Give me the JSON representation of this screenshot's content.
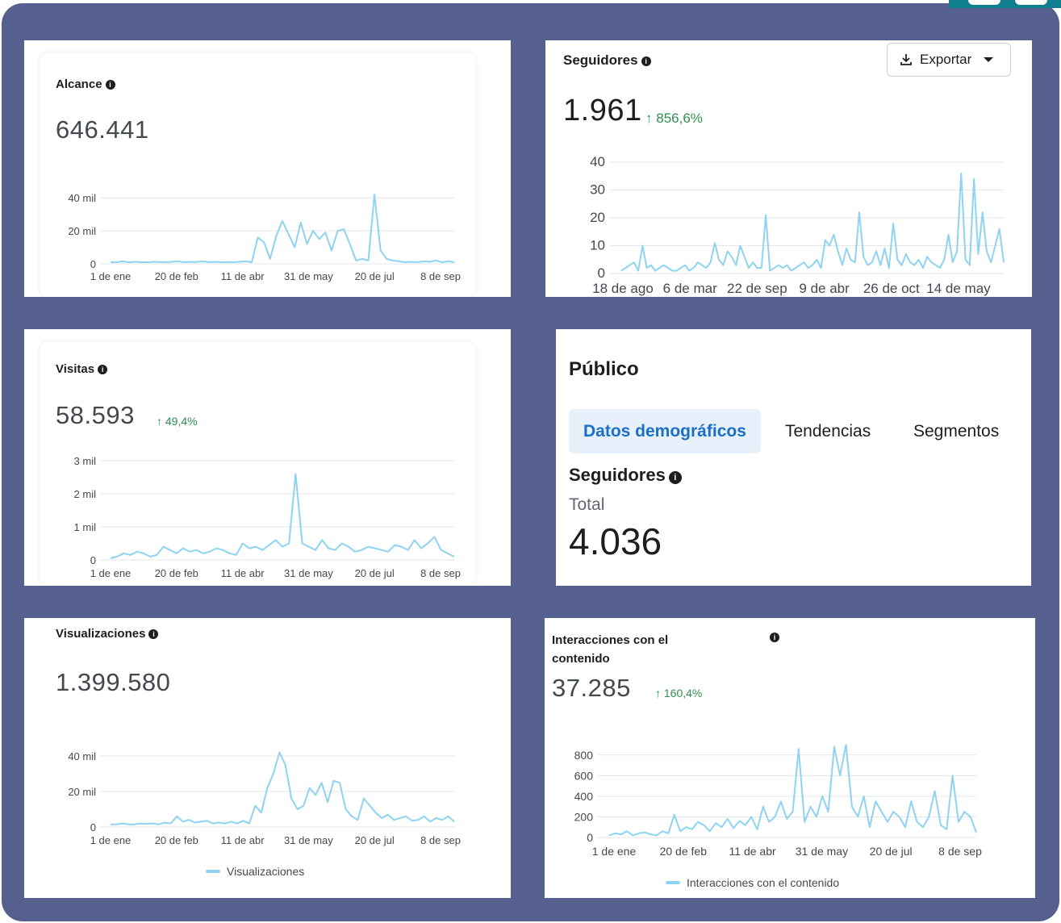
{
  "colors": {
    "frame": "#55608f",
    "line": "#8fd3f2",
    "positive": "#2f8f4f",
    "tab_active_bg": "#e7f0fb",
    "tab_active_fg": "#1a6fc7"
  },
  "alcance": {
    "title": "Alcance",
    "value": "646.441",
    "info_icon": "info-icon",
    "chart_data": {
      "type": "line",
      "x": [
        "1 de ene",
        "20 de feb",
        "11 de abr",
        "31 de may",
        "20 de jul",
        "8 de sep"
      ],
      "y_ticks": [
        "0",
        "20 mil",
        "40 mil"
      ],
      "ylim": [
        0,
        45000
      ],
      "values": [
        1000,
        1000,
        1500,
        1000,
        1200,
        1000,
        1000,
        1200,
        1100,
        1000,
        1200,
        1500,
        1000,
        1200,
        1100,
        1500,
        1000,
        1200,
        1000,
        1100,
        1000,
        1200,
        1500,
        1000,
        16000,
        13000,
        3000,
        17000,
        26000,
        18000,
        10000,
        25000,
        12000,
        20000,
        15000,
        19000,
        8000,
        20000,
        21000,
        12000,
        2000,
        3000,
        2000,
        42000,
        8000,
        3000,
        2000,
        1500,
        1000,
        1200,
        1000,
        1500,
        1200,
        2000,
        1000,
        1500,
        1000
      ]
    }
  },
  "seguidores_chart": {
    "title": "Seguidores",
    "value": "1.961",
    "delta": "856,6%",
    "export_label": "Exportar",
    "chart_data": {
      "type": "line",
      "x": [
        "18 de ago",
        "6 de mar",
        "22 de sep",
        "9 de abr",
        "26 de oct",
        "14 de may"
      ],
      "y_ticks": [
        "0",
        "10",
        "20",
        "30",
        "40"
      ],
      "ylim": [
        0,
        40
      ],
      "values": [
        1,
        2,
        3,
        4,
        1,
        10,
        2,
        3,
        1,
        2,
        3,
        2,
        1,
        1,
        2,
        3,
        1,
        2,
        4,
        3,
        2,
        4,
        11,
        5,
        3,
        8,
        6,
        3,
        10,
        6,
        2,
        4,
        2,
        2,
        21,
        1,
        2,
        3,
        2,
        3,
        1,
        2,
        3,
        4,
        2,
        3,
        5,
        2,
        12,
        10,
        14,
        8,
        3,
        9,
        5,
        4,
        22,
        6,
        3,
        4,
        8,
        3,
        9,
        2,
        18,
        5,
        3,
        7,
        4,
        3,
        5,
        2,
        6,
        4,
        3,
        2,
        5,
        14,
        4,
        8,
        36,
        5,
        3,
        34,
        7,
        22,
        8,
        4,
        10,
        16,
        4
      ]
    }
  },
  "visitas": {
    "title": "Visitas",
    "value": "58.593",
    "delta": "49,4%",
    "chart_data": {
      "type": "line",
      "x": [
        "1 de ene",
        "20 de feb",
        "11 de abr",
        "31 de may",
        "20 de jul",
        "8 de sep"
      ],
      "y_ticks": [
        "0",
        "1 mil",
        "2 mil",
        "3 mil"
      ],
      "ylim": [
        0,
        3000
      ],
      "values": [
        50,
        100,
        200,
        150,
        250,
        200,
        100,
        150,
        400,
        300,
        200,
        350,
        250,
        300,
        200,
        250,
        350,
        300,
        200,
        150,
        500,
        350,
        400,
        300,
        450,
        600,
        400,
        500,
        2600,
        500,
        400,
        300,
        600,
        350,
        300,
        500,
        400,
        250,
        300,
        400,
        350,
        300,
        250,
        450,
        400,
        300,
        600,
        350,
        500,
        700,
        300,
        200,
        100
      ]
    }
  },
  "publico": {
    "title": "Público",
    "tabs": [
      "Datos demográficos",
      "Tendencias",
      "Segmentos"
    ],
    "section_title": "Seguidores",
    "total_label": "Total",
    "total_value": "4.036"
  },
  "visualizaciones": {
    "title": "Visualizaciones",
    "value": "1.399.580",
    "legend": "Visualizaciones",
    "chart_data": {
      "type": "line",
      "x": [
        "1 de ene",
        "20 de feb",
        "11 de abr",
        "31 de may",
        "20 de jul",
        "8 de sep"
      ],
      "y_ticks": [
        "0",
        "20 mil",
        "40 mil"
      ],
      "ylim": [
        0,
        45000
      ],
      "values": [
        1500,
        1500,
        2000,
        1500,
        1500,
        2000,
        1800,
        2000,
        1500,
        2500,
        2000,
        6000,
        3000,
        4000,
        2500,
        3000,
        3500,
        2000,
        2500,
        2000,
        3000,
        2000,
        3500,
        2000,
        12000,
        8000,
        22000,
        30000,
        42000,
        35000,
        16000,
        10000,
        12000,
        22000,
        18000,
        25000,
        14000,
        26000,
        25000,
        10000,
        6000,
        4000,
        16000,
        12000,
        8000,
        5000,
        7000,
        4000,
        5000,
        6000,
        3500,
        4000,
        6000,
        3000,
        5000,
        4000,
        6000,
        3000
      ]
    }
  },
  "interacciones": {
    "title_line1": "Interacciones con el",
    "title_line2": "contenido",
    "value": "37.285",
    "delta": "160,4%",
    "legend": "Interacciones con el contenido",
    "chart_data": {
      "type": "line",
      "x": [
        "1 de ene",
        "20 de feb",
        "11 de abr",
        "31 de may",
        "20 de jul",
        "8 de sep"
      ],
      "y_ticks": [
        "0",
        "200",
        "400",
        "600",
        "800"
      ],
      "ylim": [
        0,
        900
      ],
      "values": [
        20,
        40,
        30,
        60,
        20,
        40,
        50,
        30,
        20,
        60,
        40,
        220,
        60,
        100,
        80,
        150,
        120,
        60,
        140,
        100,
        180,
        90,
        160,
        120,
        200,
        80,
        300,
        150,
        200,
        350,
        180,
        250,
        860,
        150,
        300,
        200,
        400,
        250,
        880,
        600,
        900,
        300,
        200,
        400,
        100,
        350,
        250,
        150,
        250,
        200,
        100,
        350,
        150,
        100,
        200,
        450,
        120,
        80,
        600,
        150,
        250,
        200,
        50
      ]
    }
  }
}
